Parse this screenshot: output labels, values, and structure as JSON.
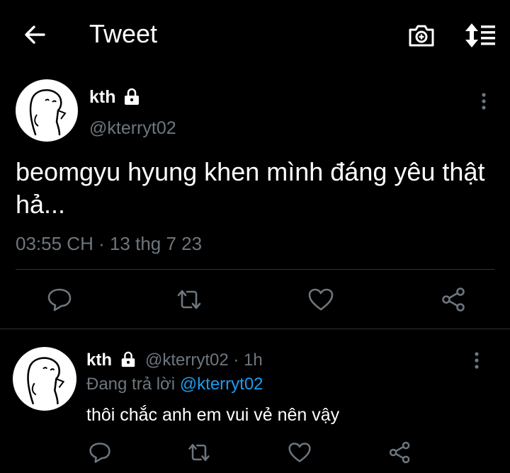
{
  "header": {
    "title": "Tweet",
    "icons": [
      "back-arrow-icon",
      "camera-icon",
      "sort-icon"
    ]
  },
  "main_tweet": {
    "name": "kth",
    "handle": "@kterryt02",
    "text": "beomgyu hyung khen mình đáng yêu thật hả...",
    "timestamp": "03:55 CH · 13 thg 7 23",
    "icons": [
      "lock-icon",
      "more-icon",
      "reply-icon",
      "retweet-icon",
      "like-icon",
      "share-icon"
    ]
  },
  "reply_tweet": {
    "name": "kth",
    "meta": "@kterryt02 · 1h",
    "replying_prefix": "Đang trả lời ",
    "replying_mention": "@kterryt02",
    "text": "thôi chắc anh em vui vẻ nên vậy",
    "icons": [
      "lock-icon",
      "more-icon",
      "reply-icon",
      "retweet-icon",
      "like-icon",
      "share-icon"
    ]
  },
  "colors": {
    "background": "#000000",
    "text": "#ffffff",
    "secondary": "#6e767d",
    "link": "#1d9bf0",
    "divider": "#2f3336"
  }
}
